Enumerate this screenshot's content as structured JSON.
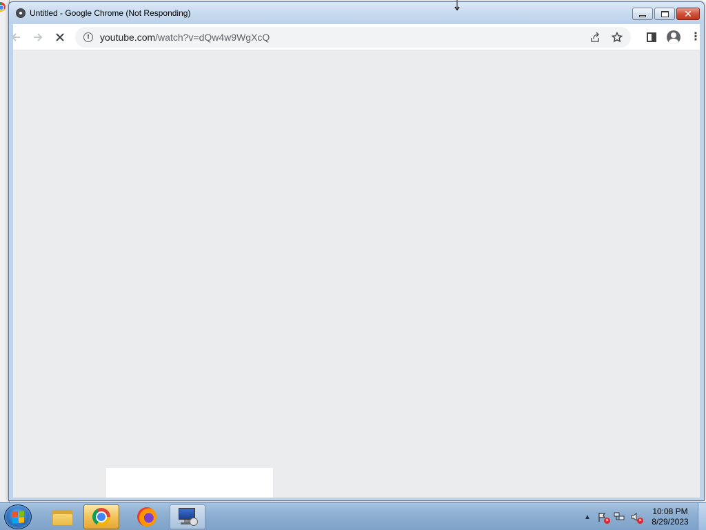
{
  "window": {
    "title": "Untitled - Google Chrome (Not Responding)"
  },
  "toolbar": {
    "url_host": "youtube.com",
    "url_path": "/watch?v=dQw4w9WgXcQ",
    "icons": {
      "back": "arrow-left-icon",
      "forward": "arrow-right-icon",
      "stop": "close-icon",
      "info": "info-icon",
      "share": "share-icon",
      "bookmark": "star-icon",
      "side_panel": "side-panel-icon",
      "profile": "profile-icon",
      "menu": "kebab-menu-icon"
    }
  },
  "taskbar": {
    "apps": [
      "Windows Explorer",
      "Google Chrome",
      "Firefox",
      "Remote Desktop Connection"
    ],
    "active_app": "Google Chrome",
    "clock_time": "10:08 PM",
    "clock_date": "8/29/2023"
  },
  "colors": {
    "content_bg": "#ebecee",
    "omnibox_bg": "#f1f3f4",
    "titlebar": "#c8dbef",
    "taskbar": "#8fb0d3"
  }
}
